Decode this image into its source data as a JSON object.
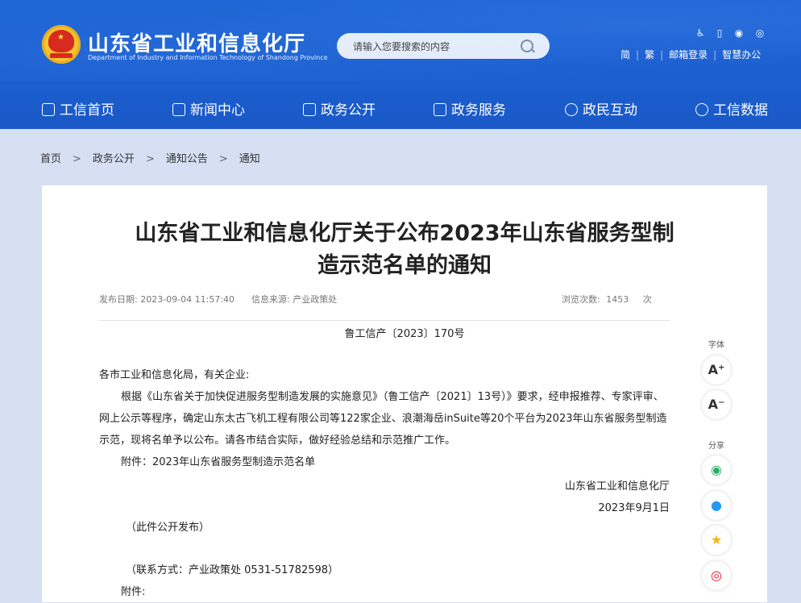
{
  "header": {
    "site_name": "山东省工业和信息化厅",
    "site_sub": "Department of Industry and Information Technology of Shandong Province",
    "search_placeholder": "请输入您要搜索的内容",
    "tool_links": [
      "简",
      "繁",
      "邮箱登录",
      "智慧办公"
    ],
    "tool_icons": [
      "accessibility-icon",
      "mobile-icon",
      "wechat-icon",
      "weibo-icon"
    ]
  },
  "nav": {
    "items": [
      {
        "label": "工信首页",
        "icon": "home-icon"
      },
      {
        "label": "新闻中心",
        "icon": "news-icon"
      },
      {
        "label": "政务公开",
        "icon": "monitor-icon"
      },
      {
        "label": "政务服务",
        "icon": "service-icon"
      },
      {
        "label": "政民互动",
        "icon": "chat-icon"
      },
      {
        "label": "工信数据",
        "icon": "database-icon"
      }
    ]
  },
  "breadcrumb": {
    "items": [
      "首页",
      "政务公开",
      "通知公告",
      "通知"
    ],
    "separator": ">"
  },
  "article": {
    "title_line1": "山东省工业和信息化厅关于公布2023年山东省服务型制",
    "title_line2": "造示范名单的通知",
    "publish_label": "发布日期:",
    "publish_date": "2023-09-04 11:57:40",
    "source_label": "信息来源:",
    "source": "产业政策处",
    "views_label": "浏览次数:",
    "views": "1453",
    "views_unit": "次",
    "doc_no": "鲁工信产〔2023〕170号",
    "salutation": "各市工业和信息化局，有关企业:",
    "paragraph": "根据《山东省关于加快促进服务型制造发展的实施意见》（鲁工信产〔2021〕13号）》要求，经申报推荐、专家评审、网上公示等程序，确定山东太古飞机工程有限公司等122家企业、浪潮海岳inSuite等20个平台为2023年山东省服务型制造示范，现将名单予以公布。请各市结合实际，做好经验总结和示范推广工作。",
    "attachment_line": "附件：2023年山东省服务型制造示范名单",
    "signature_org": "山东省工业和信息化厅",
    "signature_date": "2023年9月1日",
    "public_note": "（此件公开发布）",
    "contact": "（联系方式：产业政策处  0531-51782598）",
    "attachment_label": "附件:"
  },
  "side_tools": {
    "font_label": "字体",
    "font_increase": "A⁺",
    "font_decrease": "A⁻",
    "share_label": "分享",
    "share_icons": [
      "wechat-share-icon",
      "qq-share-icon",
      "qzone-share-icon",
      "weibo-share-icon"
    ]
  },
  "colors": {
    "header_blue": "#1c5fcf",
    "page_bg": "#d6e0f2",
    "wechat_green": "#2aae67",
    "qq_blue": "#1e9bf0",
    "qzone_yellow": "#f6b21b",
    "weibo_red": "#e6162d"
  }
}
